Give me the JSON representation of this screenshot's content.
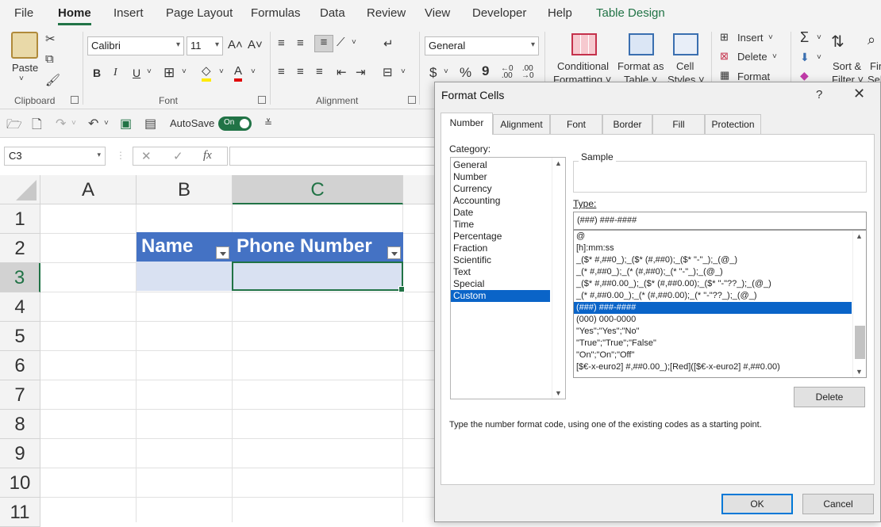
{
  "menu": {
    "tabs": [
      "File",
      "Home",
      "Insert",
      "Page Layout",
      "Formulas",
      "Data",
      "Review",
      "View",
      "Developer",
      "Help",
      "Table Design"
    ]
  },
  "ribbon": {
    "clipboard": {
      "paste": "Paste",
      "label": "Clipboard"
    },
    "font": {
      "name": "Calibri",
      "size": "11",
      "grow": "A˄",
      "shrink": "A˅",
      "bold": "B",
      "italic": "I",
      "underline": "U",
      "color": "A",
      "label": "Font"
    },
    "alignment": {
      "label": "Alignment"
    },
    "number": {
      "format": "General",
      "currency": "$",
      "percent": "%",
      "comma": "9",
      "label": ""
    },
    "styles": {
      "conditional_line1": "Conditional",
      "conditional_line2": "Formatting ˅",
      "format_as_line1": "Format as",
      "format_as_line2": "Table ˅",
      "cell_line1": "Cell",
      "cell_line2": "Styles ˅"
    },
    "cells": {
      "insert": "Insert",
      "delete": "Delete",
      "format": "Format"
    },
    "editing": {
      "sort_line1": "Sort &",
      "sort_line2": "Filter ˅",
      "find_line1": "Fin",
      "find_line2": "Sel"
    }
  },
  "qat": {
    "autosave_label": "AutoSave",
    "autosave_state": "On"
  },
  "formula_bar": {
    "name_box": "C3",
    "cancel": "✕",
    "enter": "✓",
    "fx": "fx",
    "value": ""
  },
  "grid": {
    "columns": [
      "A",
      "B",
      "C"
    ],
    "rows": [
      "1",
      "2",
      "3",
      "4",
      "5",
      "6",
      "7",
      "8",
      "9",
      "10",
      "11"
    ],
    "table_headers": [
      "Name",
      "Phone Number"
    ]
  },
  "dialog": {
    "title": "Format Cells",
    "help": "?",
    "close": "✕",
    "tabs": [
      "Number",
      "Alignment",
      "Font",
      "Border",
      "Fill",
      "Protection"
    ],
    "category_label": "Category:",
    "categories": [
      "General",
      "Number",
      "Currency",
      "Accounting",
      "Date",
      "Time",
      "Percentage",
      "Fraction",
      "Scientific",
      "Text",
      "Special",
      "Custom"
    ],
    "selected_category": "Custom",
    "sample_label": "Sample",
    "type_label": "Type:",
    "type_value": "(###) ###-####",
    "formats": [
      "@",
      "[h]:mm:ss",
      "_($* #,##0_);_($* (#,##0);_($* \"-\"_);_(@_)",
      "_(* #,##0_);_(* (#,##0);_(* \"-\"_);_(@_)",
      "_($* #,##0.00_);_($* (#,##0.00);_($* \"-\"??_);_(@_)",
      "_(* #,##0.00_);_(* (#,##0.00);_(* \"-\"??_);_(@_)",
      "(###) ###-####",
      "(000) 000-0000",
      "\"Yes\";\"Yes\";\"No\"",
      "\"True\";\"True\";\"False\"",
      "\"On\";\"On\";\"Off\"",
      "[$€-x-euro2] #,##0.00_);[Red]([$€-x-euro2] #,##0.00)"
    ],
    "selected_format": "(###) ###-####",
    "delete_button": "Delete",
    "hint": "Type the number format code, using one of the existing codes as a starting point.",
    "ok_button": "OK",
    "cancel_button": "Cancel"
  },
  "colors": {
    "excel_green": "#217346",
    "table_header": "#4472c4",
    "table_band": "#d9e1f2",
    "selection_blue": "#0a64c8"
  }
}
